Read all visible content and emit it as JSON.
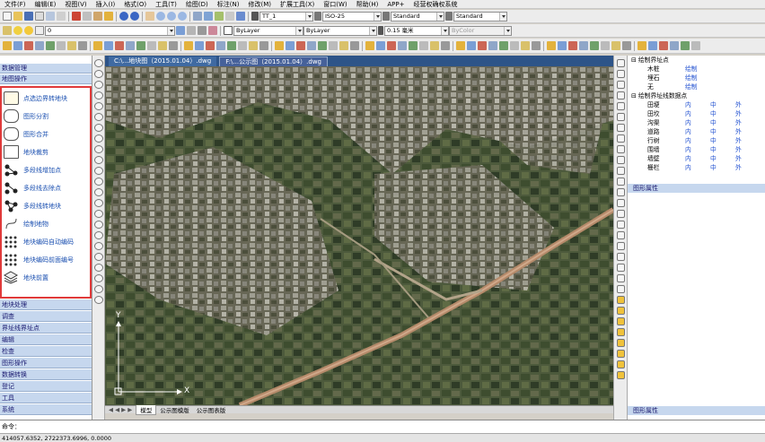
{
  "menu": [
    "文件(F)",
    "编辑(E)",
    "视图(V)",
    "插入(I)",
    "格式(O)",
    "工具(T)",
    "绘图(D)",
    "标注(N)",
    "修改(M)",
    "扩展工具(X)",
    "窗口(W)",
    "帮助(H)",
    "APP+",
    "经营权确权系统"
  ],
  "toolbar": {
    "text_style": "TT_1",
    "dim_style": "ISO-25",
    "table_style": "Standard",
    "multileader_style": "Standard",
    "layer": "0",
    "color": "ByLayer",
    "linetype": "ByLayer",
    "lineweight": "0.15 毫米",
    "plot_style": "ByColor"
  },
  "left_panel": {
    "top_header": "数据管理",
    "tool_header": "地图操作",
    "tools": [
      "点选边界转地块",
      "图形分割",
      "图形合并",
      "地块裁剪",
      "多段线增加点",
      "多段线去除点",
      "多段线转地块",
      "绘制地物",
      "地块编码自动编码",
      "地块编码前面编号",
      "地块前置"
    ],
    "bottom_sections": [
      "地块处理",
      "调查",
      "界址线界址点",
      "编辑",
      "检查",
      "图形操作",
      "数据转换",
      "登记",
      "工具",
      "系统"
    ]
  },
  "doc_tabs": [
    "C:\\...地块图（2015.01.04）.dwg",
    "F:\\...公示图（2015.01.04）.dwg"
  ],
  "layout_tabs": [
    "模型",
    "公示图模版",
    "公示图表版"
  ],
  "right_panel": {
    "section1": "绘制界址点",
    "rows1": [
      {
        "name": "木桩",
        "a": "绘制"
      },
      {
        "name": "埋石",
        "a": "绘制"
      },
      {
        "name": "无",
        "a": "绘制"
      }
    ],
    "section2": "绘制界址线数据点",
    "rows2": [
      {
        "name": "田埂",
        "a": "内",
        "b": "中",
        "c": "外"
      },
      {
        "name": "田坎",
        "a": "内",
        "b": "中",
        "c": "外"
      },
      {
        "name": "沟渠",
        "a": "内",
        "b": "中",
        "c": "外"
      },
      {
        "name": "道路",
        "a": "内",
        "b": "中",
        "c": "外"
      },
      {
        "name": "行树",
        "a": "内",
        "b": "中",
        "c": "外"
      },
      {
        "name": "围墙",
        "a": "内",
        "b": "中",
        "c": "外"
      },
      {
        "name": "墙壁",
        "a": "内",
        "b": "中",
        "c": "外"
      },
      {
        "name": "栅栏",
        "a": "内",
        "b": "中",
        "c": "外"
      }
    ],
    "props_header": "图形属性",
    "bottom_header": "图形属性"
  },
  "command": {
    "prompt": "命令："
  },
  "status": {
    "coords": "414057.6352, 2722373.6996, 0.0000"
  },
  "axis": {
    "x_label": "X",
    "y_label": "Y"
  },
  "colors": {
    "accent": "#2d5488",
    "highlight": "#e03a3a",
    "link": "#1f4fd0"
  }
}
